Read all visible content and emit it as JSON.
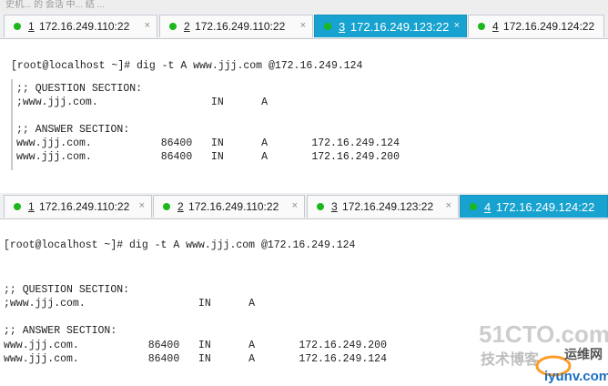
{
  "browser_strip_text": "史机... 的 会话 中... 结 ...",
  "top_pane": {
    "tabs": [
      {
        "num": "1",
        "host": "172.16.249.110:22",
        "active": false
      },
      {
        "num": "2",
        "host": "172.16.249.110:22",
        "active": false
      },
      {
        "num": "3",
        "host": "172.16.249.123:22",
        "active": true
      },
      {
        "num": "4",
        "host": "172.16.249.124:22",
        "active": false
      }
    ],
    "lines": [
      "[root@localhost ~]# dig -t A www.jjj.com @172.16.249.124",
      ";; QUESTION SECTION:",
      ";www.jjj.com.                  IN      A",
      ";; ANSWER SECTION:",
      "www.jjj.com.           86400   IN      A       172.16.249.124",
      "www.jjj.com.           86400   IN      A       172.16.249.200"
    ]
  },
  "bottom_pane": {
    "tabs": [
      {
        "num": "1",
        "host": "172.16.249.110:22",
        "active": false
      },
      {
        "num": "2",
        "host": "172.16.249.110:22",
        "active": false
      },
      {
        "num": "3",
        "host": "172.16.249.123:22",
        "active": false
      },
      {
        "num": "4",
        "host": "172.16.249.124:22",
        "active": true
      }
    ],
    "lines": [
      "[root@localhost ~]# dig -t A www.jjj.com @172.16.249.124",
      ";; QUESTION SECTION:",
      ";www.jjj.com.                  IN      A",
      ";; ANSWER SECTION:",
      "www.jjj.com.           86400   IN      A       172.16.249.200",
      "www.jjj.com.           86400   IN      A       172.16.249.124"
    ]
  },
  "close_glyph": "×",
  "watermark": {
    "site": "51CTO.com",
    "tagline": "技术博客",
    "sub": "运维网",
    "url": "iyunv.com"
  },
  "colors": {
    "active_tab": "#17a2cf",
    "status_dot": "#1cb71c"
  }
}
